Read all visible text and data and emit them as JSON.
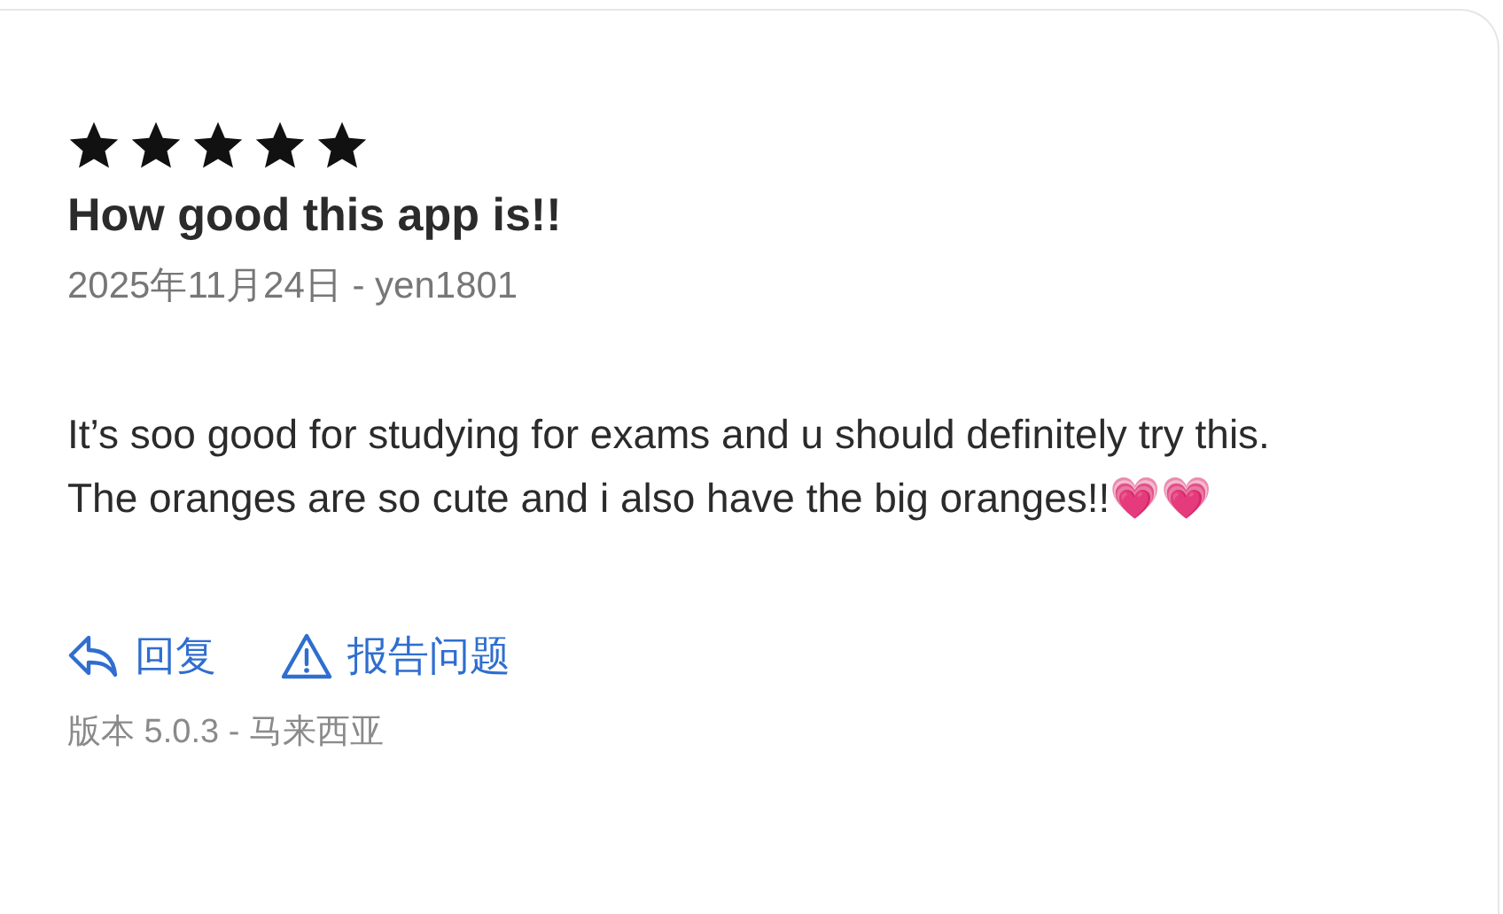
{
  "review": {
    "stars": 5,
    "title": "How good this app is!!",
    "meta": "2025年11月24日 - yen1801",
    "body": "It’s soo good for studying for exams and u should definitely try this. The oranges are so cute and i also have the big oranges!!💗💗",
    "actions": [
      {
        "kind": "reply",
        "label": "回复"
      },
      {
        "kind": "report",
        "label": "报告问题"
      }
    ],
    "version": "版本 5.0.3 - 马来西亚"
  }
}
